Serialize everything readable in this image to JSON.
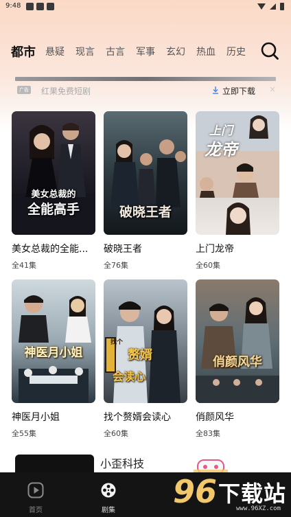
{
  "status_bar": {
    "time": "9:48"
  },
  "tabs": [
    {
      "label": "都市",
      "active": true
    },
    {
      "label": "悬疑",
      "active": false
    },
    {
      "label": "现言",
      "active": false
    },
    {
      "label": "古言",
      "active": false
    },
    {
      "label": "军事",
      "active": false
    },
    {
      "label": "玄幻",
      "active": false
    },
    {
      "label": "热血",
      "active": false
    },
    {
      "label": "历史",
      "active": false
    }
  ],
  "ad_banner": {
    "badge": "广告",
    "title": "红果免费短剧",
    "download_label": "立即下载",
    "close": "×"
  },
  "dramas": [
    {
      "title": "美女总裁的全能...",
      "episodes": "全41集",
      "poster_text": [
        "美女总裁的",
        "全能高手"
      ]
    },
    {
      "title": "破晓王者",
      "episodes": "全76集",
      "poster_text": [
        "破晓王者"
      ]
    },
    {
      "title": "上门龙帝",
      "episodes": "全60集",
      "poster_text": [
        "上门",
        "龙帝"
      ]
    },
    {
      "title": "神医月小姐",
      "episodes": "全55集",
      "poster_text": [
        "神医月小姐"
      ]
    },
    {
      "title": "找个赘婿会读心",
      "episodes": "全60集",
      "poster_text": [
        "找个",
        "赘婿",
        "会读心"
      ]
    },
    {
      "title": "俏颜风华",
      "episodes": "全83集",
      "poster_text": [
        "俏颜风华"
      ]
    }
  ],
  "bottom_ad": {
    "name": "小歪科技"
  },
  "bottom_nav": [
    {
      "label": "首页",
      "icon": "play-icon",
      "active": false
    },
    {
      "label": "剧集",
      "icon": "film-reel-icon",
      "active": true
    }
  ],
  "watermark": {
    "digits": "96",
    "text": "下载站",
    "url": "www.96XZ.com"
  },
  "colors": {
    "active_tab": "#111111",
    "nav_bg": "#141414",
    "watermark_gold": "#f3c76b"
  }
}
